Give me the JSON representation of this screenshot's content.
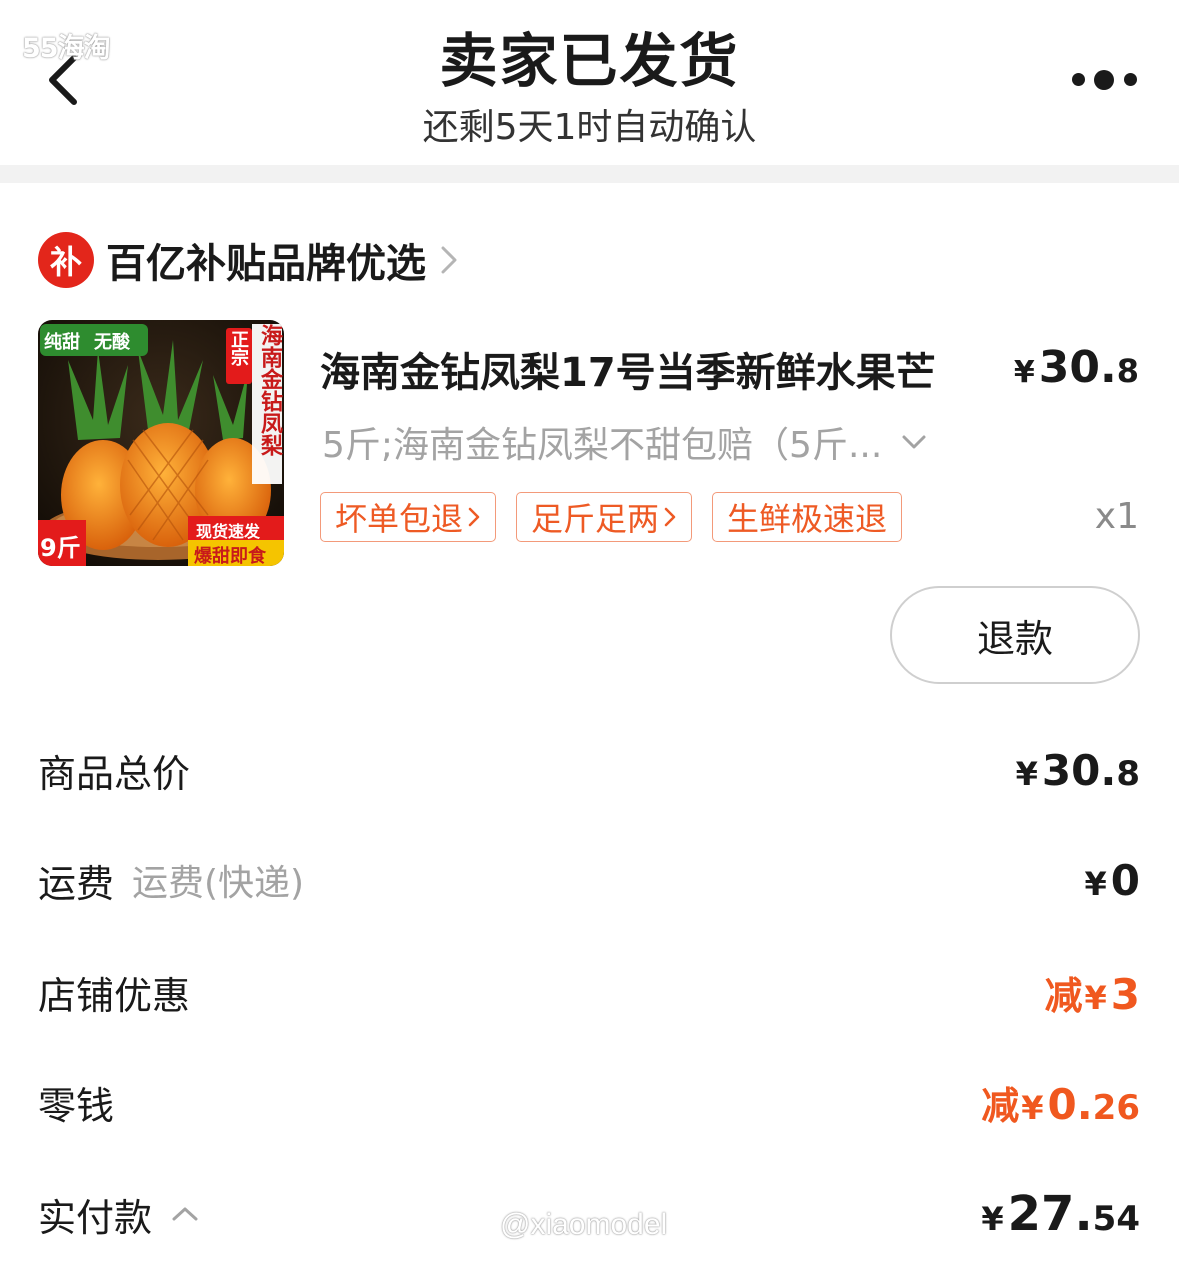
{
  "watermark": {
    "top": "55海淘",
    "bottom": "@xiaomodel"
  },
  "header": {
    "title": "卖家已发货",
    "subtitle": "还剩5天1时自动确认"
  },
  "store": {
    "logo_text": "补",
    "name": "百亿补贴品牌优选"
  },
  "product": {
    "name": "海南金钻凤梨17号当季新鲜水果芒",
    "price_yen": "¥",
    "price_int": "30.",
    "price_dec": "8",
    "spec": "5斤;海南金钻凤梨不甜包赔（5斤...",
    "tags": [
      "坏单包退",
      "足斤足两",
      "生鲜极速退"
    ],
    "quantity": "x1",
    "image_texts": {
      "top_left_1": "纯甜",
      "top_left_2": "无酸",
      "vertical_badge": "正宗",
      "vertical_title": "海南金钻凤梨",
      "bottom_left": "9斤",
      "bottom_right_1": "现货速发",
      "bottom_right_2": "爆甜即食"
    }
  },
  "refund_label": "退款",
  "summary": {
    "goods_total": {
      "label": "商品总价",
      "yen": "¥",
      "int": "30.",
      "dec": "8"
    },
    "shipping": {
      "label": "运费",
      "sub": "运费(快递)",
      "yen": "¥",
      "int": "0"
    },
    "store_discount": {
      "label": "店铺优惠",
      "prefix": "减",
      "yen": "¥",
      "int": "3"
    },
    "change": {
      "label": "零钱",
      "prefix": "减",
      "yen": "¥",
      "int": "0.",
      "dec": "26"
    },
    "paid": {
      "label": "实付款",
      "yen": "¥",
      "int": "27.",
      "dec": "54"
    }
  },
  "colors": {
    "accent_red": "#f0581f",
    "tag_border": "#f39a7a",
    "logo_red": "#e3261b",
    "muted": "#a3a3a3"
  }
}
